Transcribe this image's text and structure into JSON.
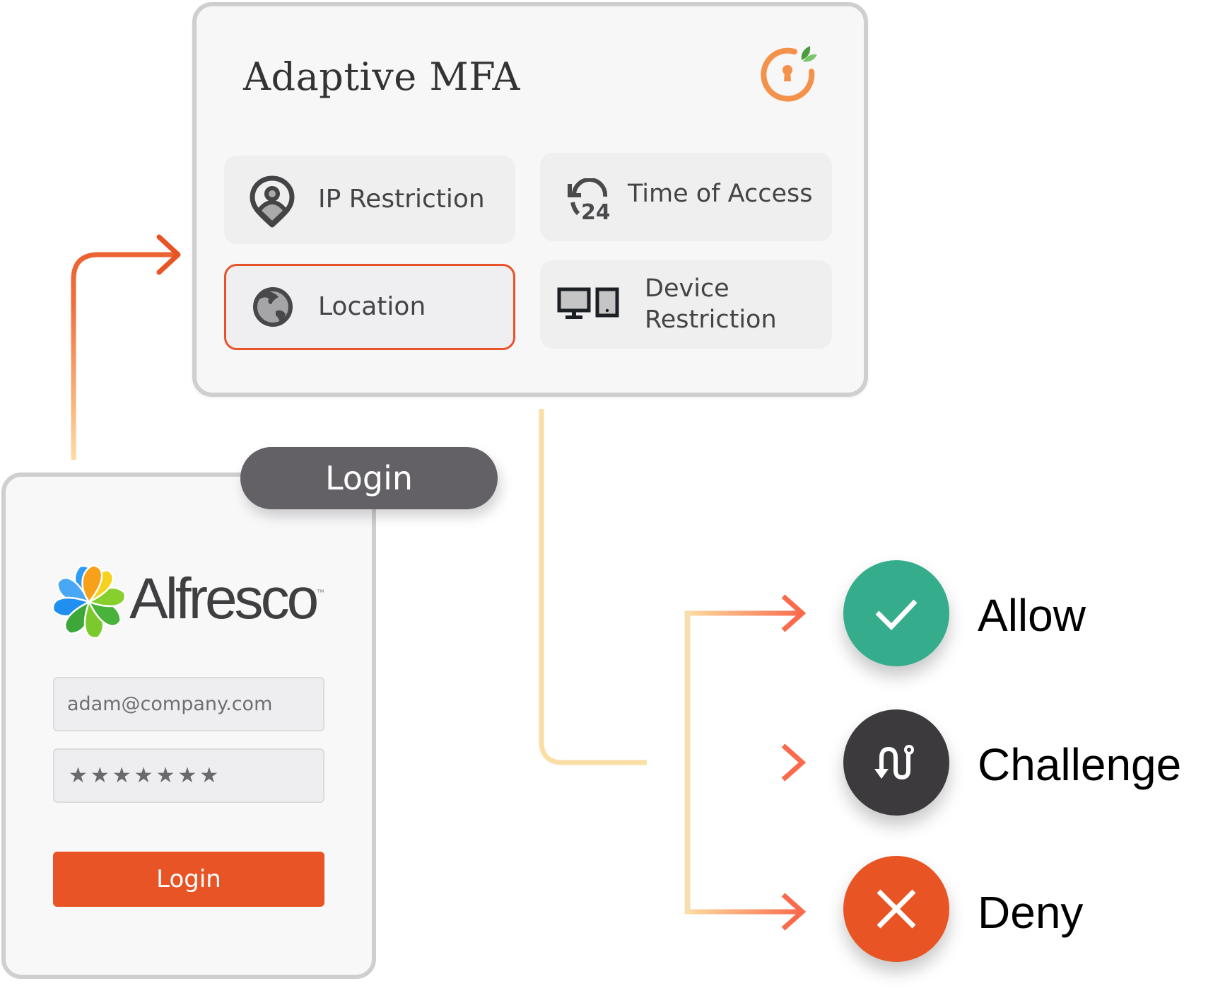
{
  "mfa_card": {
    "title": "Adaptive MFA",
    "logo_icon": "orange-keyhole-power-icon",
    "tiles": [
      {
        "label": "IP Restriction",
        "icon": "user-location-pin-icon",
        "selected": false
      },
      {
        "label": "Time of Access",
        "icon": "clock-24-hours-icon",
        "selected": false
      },
      {
        "label": "Location",
        "icon": "globe-icon",
        "selected": true
      },
      {
        "label_line1": "Device",
        "label_line2": "Restriction",
        "icon": "monitor-tablet-icon",
        "selected": false
      }
    ]
  },
  "login_card": {
    "badge": "Login",
    "brand": "Alfresco",
    "brand_tm": "™",
    "email_value": "adam@company.com",
    "password_mask": "★★★★★★★",
    "button_label": "Login"
  },
  "outcomes": [
    {
      "label": "Allow",
      "icon": "check-icon",
      "color": "#35ac8c"
    },
    {
      "label": "Challenge",
      "icon": "route-icon",
      "color": "#3c3a3d"
    },
    {
      "label": "Deny",
      "icon": "close-icon",
      "color": "#e85424"
    }
  ],
  "colors": {
    "accent": "#e95426",
    "connector_start": "#fddca0",
    "connector_end": "#fa6a4c",
    "card_border": "#cfcfd1"
  }
}
